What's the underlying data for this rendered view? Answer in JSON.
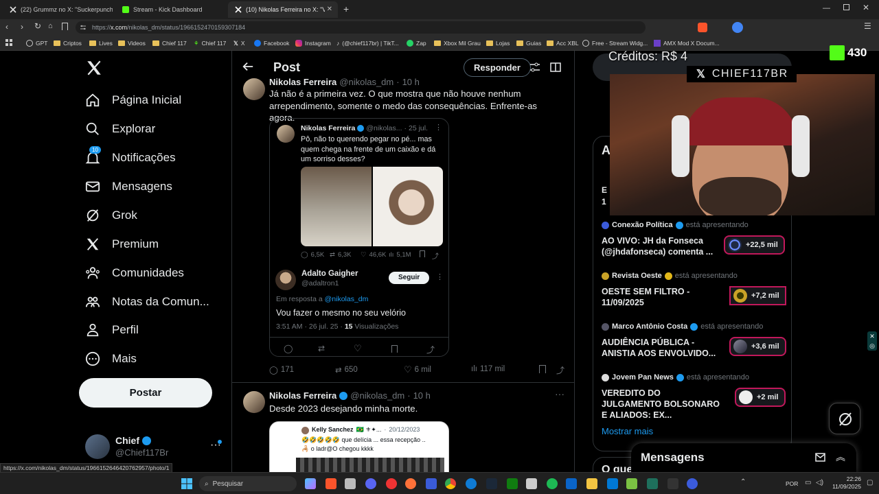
{
  "browser": {
    "tabs": [
      {
        "title": "(22) Grummz no X: \"Suckerpunch Se",
        "active": false
      },
      {
        "title": "Stream - Kick Dashboard",
        "active": false
      },
      {
        "title": "(10) Nikolas Ferreira no X: \"Você",
        "active": true
      }
    ],
    "new_tab": "+",
    "url_prefix": "https://",
    "url_domain": "x.com",
    "url_path": "/nikolas_dm/status/1966152470159307184",
    "bookmarks": [
      "GPT",
      "Criptos",
      "Lives",
      "Videos",
      "Chief 117",
      "Chief 117",
      "X",
      "Facebook",
      "Instagram",
      "(@chief117br) | TikT...",
      "Zap",
      "Xbox Mil Grau",
      "Lojas",
      "Guias",
      "Acc XBL",
      "Free - Stream Widg...",
      "AMX Mod X Docum..."
    ]
  },
  "sidebar": {
    "items": [
      {
        "label": "Página Inicial",
        "icon": "home-icon"
      },
      {
        "label": "Explorar",
        "icon": "search-icon"
      },
      {
        "label": "Notificações",
        "icon": "bell-icon",
        "badge": "10"
      },
      {
        "label": "Mensagens",
        "icon": "mail-icon"
      },
      {
        "label": "Grok",
        "icon": "grok-icon"
      },
      {
        "label": "Premium",
        "icon": "x-logo-icon"
      },
      {
        "label": "Comunidades",
        "icon": "people-icon"
      },
      {
        "label": "Notas da Comun...",
        "icon": "notes-icon"
      },
      {
        "label": "Perfil",
        "icon": "person-icon"
      },
      {
        "label": "Mais",
        "icon": "more-circle-icon"
      }
    ],
    "post_button": "Postar",
    "account": {
      "name": "Chief",
      "handle": "@Chief117Br"
    }
  },
  "header": {
    "title": "Post",
    "reply_button": "Responder"
  },
  "post1": {
    "author": "Nikolas Ferreira",
    "handle": "@nikolas_dm",
    "time": "10 h",
    "text": "Já não é a primeira vez. O que mostra que não houve nenhum arrependimento, somente o medo das consequências. Enfrente-as agora.",
    "quoted": {
      "author": "Nikolas Ferreira",
      "handle": "@nikolas...",
      "date": "25 jul.",
      "text": "Pô, não to querendo pegar no pé... mas quem chega na frente de um caixão e dá um sorriso desses?",
      "stats": {
        "replies": "6,5K",
        "reposts": "6,3K",
        "likes": "46,6K",
        "views": "5,1M"
      },
      "reply": {
        "author": "Adalto Gaigher",
        "handle": "@adaltron1",
        "follow": "Seguir",
        "in_reply_prefix": "Em resposta a",
        "in_reply_handle": "@nikolas_dm",
        "text": "Vou fazer o mesmo no seu velório",
        "meta_time": "3:51 AM · 26 jul. 25 ·",
        "meta_views": "15",
        "meta_views_label": "Visualizações"
      }
    },
    "stats": {
      "replies": "171",
      "reposts": "650",
      "likes": "6 mil",
      "views": "117 mil"
    }
  },
  "post2": {
    "author": "Nikolas Ferreira",
    "handle": "@nikolas_dm",
    "time": "10 h",
    "text": "Desde 2023 desejando minha morte.",
    "quoted": {
      "author": "Kelly Sanchez",
      "author_suffix": "🇧🇷 ⚜✦...",
      "date": "20/12/2023",
      "line1_emoji": "🤣🤣🤣🤣🤣",
      "line1": "que delícia ... essa recepção ..",
      "line2": "o ladr@O chegou kkkk"
    }
  },
  "overlay": {
    "credits": "Créditos: R$ 4",
    "kick_count": "430",
    "channel": "CHIEF117BR"
  },
  "live": {
    "items": [
      {
        "host": "Conexão Política",
        "presenting": "está apresentando",
        "title": "AO VIVO: JH da Fonseca (@jhdafonseca) comenta ...",
        "count": "+22,5 mil"
      },
      {
        "host": "Revista Oeste",
        "presenting": "está apresentando",
        "title": "OESTE SEM FILTRO - 11/09/2025",
        "count": "+7,2 mil"
      },
      {
        "host": "Marco Antônio Costa",
        "presenting": "está apresentando",
        "title": "AUDIÊNCIA PÚBLICA - ANISTIA AOS ENVOLVIDO...",
        "count": "+3,6 mil"
      },
      {
        "host": "Jovem Pan News",
        "presenting": "está apresentando",
        "title": "VEREDITO DO JULGAMENTO BOLSONARO E ALIADOS: EX...",
        "count": "+2 mil"
      }
    ],
    "show_more": "Mostrar mais",
    "partial_e": "E",
    "partial_1": "1",
    "partial_a": "A",
    "partial_o": "O que"
  },
  "messages": {
    "title": "Mensagens"
  },
  "statusbar": {
    "url": "https://x.com/nikolas_dm/status/1966152646420762957/photo/1"
  },
  "taskbar": {
    "search": "Pesquisar",
    "lang": "POR",
    "time": "22:26",
    "date": "11/09/2025"
  },
  "colors": {
    "accent": "#1d9bf0",
    "kick": "#53fc18",
    "live_border": "#c2185b"
  }
}
